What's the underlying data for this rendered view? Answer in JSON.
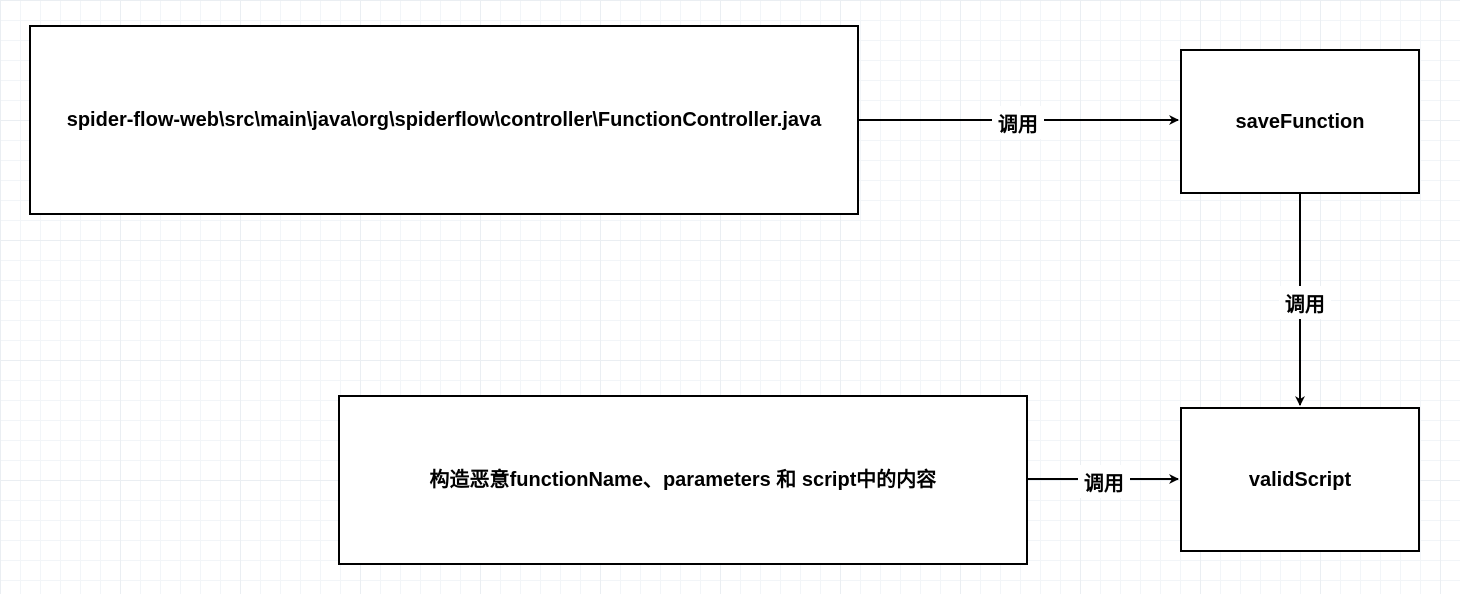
{
  "nodes": {
    "controller": {
      "label": "spider-flow-web\\src\\main\\java\\org\\spiderflow\\controller\\FunctionController.java"
    },
    "saveFunction": {
      "label": "saveFunction"
    },
    "payload": {
      "label": "构造恶意functionName、parameters 和 script中的内容"
    },
    "validScript": {
      "label": "validScript"
    }
  },
  "edges": {
    "e1": {
      "label": "调用"
    },
    "e2": {
      "label": "调用"
    },
    "e3": {
      "label": "调用"
    }
  }
}
